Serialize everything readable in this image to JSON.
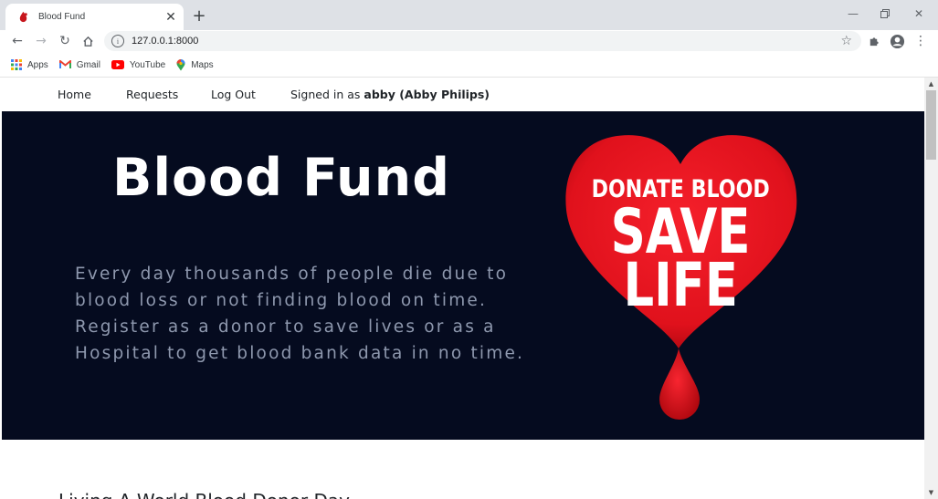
{
  "browser": {
    "tab_title": "Blood Fund",
    "tab_icon": "blood-drop-favicon",
    "address": "127.0.0.1:8000",
    "bookmarks": [
      {
        "label": "Apps",
        "icon": "apps-grid-icon"
      },
      {
        "label": "Gmail",
        "icon": "gmail-icon"
      },
      {
        "label": "YouTube",
        "icon": "youtube-icon"
      },
      {
        "label": "Maps",
        "icon": "maps-pin-icon"
      }
    ]
  },
  "nav": {
    "home": "Home",
    "requests": "Requests",
    "logout": "Log Out",
    "signed_prefix": "Signed in as",
    "signed_user": "abby (Abby Philips)"
  },
  "hero": {
    "title": "Blood Fund",
    "lines": [
      "Every day thousands of people die due to",
      "blood loss or not finding blood on time.",
      "Register as a donor to save lives or as a",
      "Hospital to get blood bank data in no time."
    ],
    "badge": {
      "line1": "DONATE BLOOD",
      "line2": "SAVE",
      "line3": "LIFE"
    }
  },
  "section": {
    "title": "Living A World Blood Donor Day"
  },
  "colors": {
    "hero_bg": "#050b1f",
    "heart_red": "#e8101c",
    "hero_text": "#8e98ae"
  }
}
